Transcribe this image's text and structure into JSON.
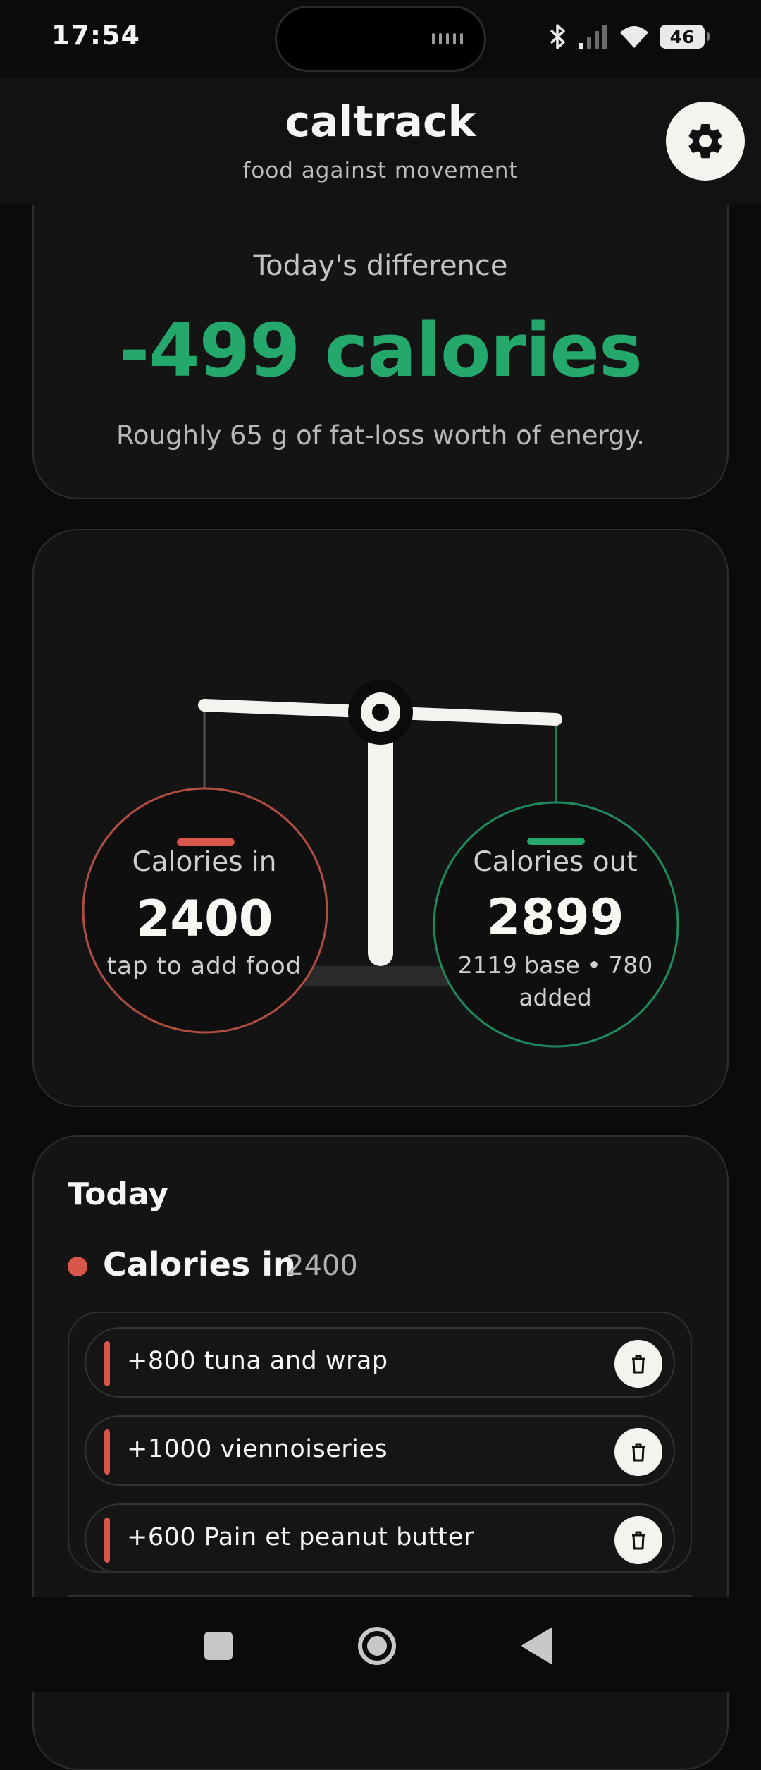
{
  "status_bar": {
    "time": "17:54",
    "battery": "46",
    "icons": [
      "bluetooth-icon",
      "signal-icon",
      "wifi-icon",
      "battery-icon"
    ]
  },
  "header": {
    "title": "caltrack",
    "subtitle": "food against movement",
    "settings_icon": "gear-icon"
  },
  "difference": {
    "label": "Today's difference",
    "value": "-499 calories",
    "note": "Roughly 65 g of fat-loss worth of energy.",
    "color": "#25a86b"
  },
  "scale": {
    "calories_in": {
      "label": "Calories in",
      "value": "2400",
      "hint": "tap to add food",
      "color": "#d9574a"
    },
    "calories_out": {
      "label": "Calories out",
      "value": "2899",
      "sub": "2119 base  •  780 added",
      "color": "#25a86b"
    }
  },
  "today": {
    "title": "Today",
    "calories_in_section": {
      "label": "Calories in",
      "total": "2400",
      "entries": [
        {
          "text": "+800 tuna and wrap"
        },
        {
          "text": "+1000 viennoiseries"
        },
        {
          "text": "+600 Pain et peanut butter"
        }
      ]
    }
  },
  "colors": {
    "background": "#0b0b0b",
    "card": "#141414",
    "accent_in": "#d9574a",
    "accent_out": "#25a86b",
    "light": "#f3f3ef"
  }
}
